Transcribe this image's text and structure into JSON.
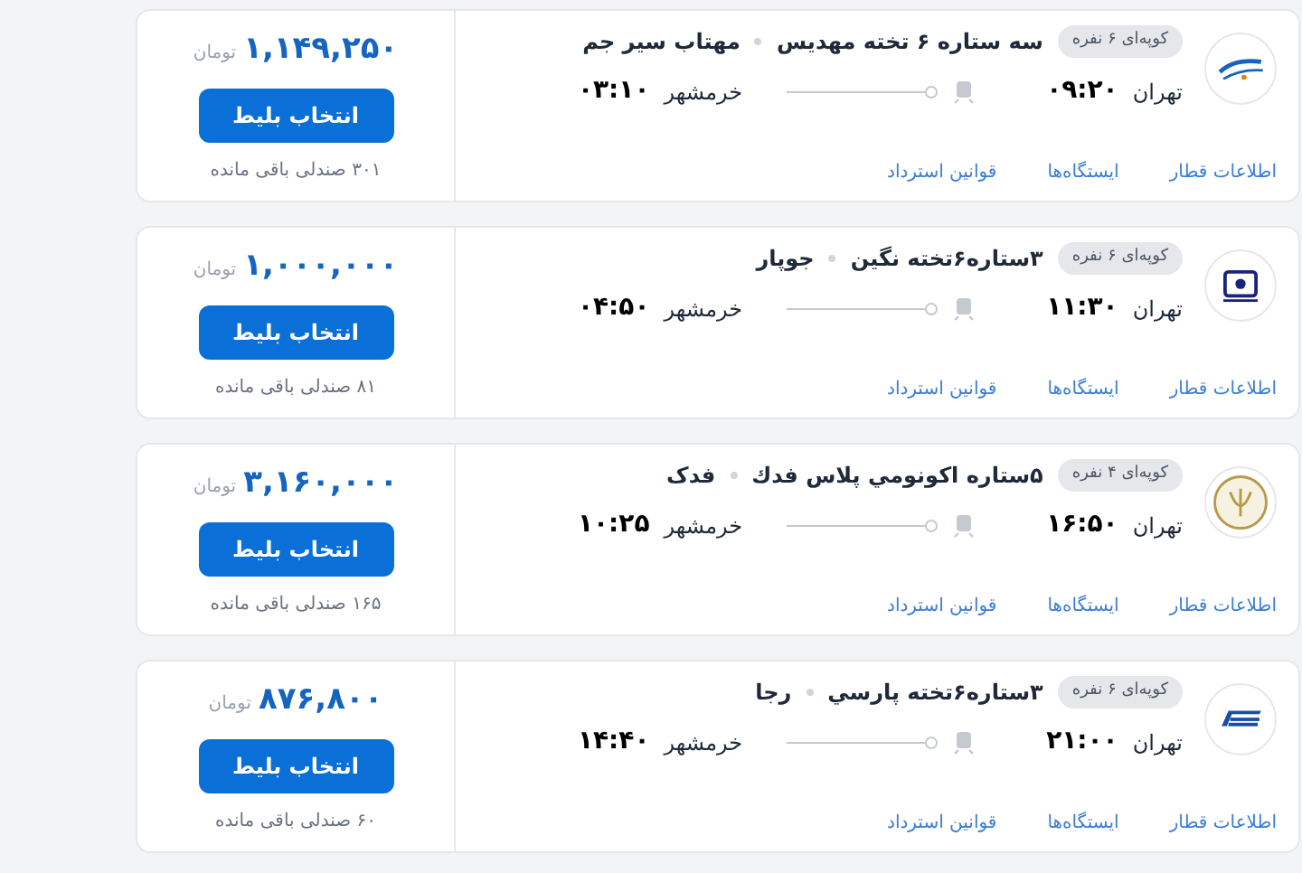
{
  "trips": [
    {
      "logo": {
        "kind": "wave"
      },
      "coupe": "کوپه‌ای ۶ نفره",
      "train_name": "سه ستاره ۶ تخته مهدیس",
      "company": "مهتاب سیر جم",
      "origin": "تهران",
      "depart": "۰۹:۲۰",
      "destination": "خرمشهر",
      "arrive": "۰۳:۱۰",
      "links": [
        "اطلاعات قطار",
        "ایستگاه‌ها",
        "قوانین استرداد"
      ],
      "price": "۱,۱۴۹,۲۵۰",
      "currency": "تومان",
      "button": "انتخاب بلیط",
      "seats": "۳۰۱ صندلی باقی مانده"
    },
    {
      "logo": {
        "kind": "square"
      },
      "coupe": "کوپه‌ای ۶ نفره",
      "train_name": "۳ستاره۶تخته نگین",
      "company": "جوپار",
      "origin": "تهران",
      "depart": "۱۱:۳۰",
      "destination": "خرمشهر",
      "arrive": "۰۴:۵۰",
      "links": [
        "اطلاعات قطار",
        "ایستگاه‌ها",
        "قوانین استرداد"
      ],
      "price": "۱,۰۰۰,۰۰۰",
      "currency": "تومان",
      "button": "انتخاب بلیط",
      "seats": "۸۱ صندلی باقی مانده"
    },
    {
      "logo": {
        "kind": "emblem"
      },
      "coupe": "کوپه‌ای ۴ نفره",
      "train_name": "۵ستاره اکونومي پلاس فدك",
      "company": "فدک",
      "origin": "تهران",
      "depart": "۱۶:۵۰",
      "destination": "خرمشهر",
      "arrive": "۱۰:۲۵",
      "links": [
        "اطلاعات قطار",
        "ایستگاه‌ها",
        "قوانین استرداد"
      ],
      "price": "۳,۱۶۰,۰۰۰",
      "currency": "تومان",
      "button": "انتخاب بلیط",
      "seats": "۱۶۵ صندلی باقی مانده"
    },
    {
      "logo": {
        "kind": "stripes"
      },
      "coupe": "کوپه‌ای ۶ نفره",
      "train_name": "۳ستاره۶تخته پارسي",
      "company": "رجا",
      "origin": "تهران",
      "depart": "۲۱:۰۰",
      "destination": "خرمشهر",
      "arrive": "۱۴:۴۰",
      "links": [
        "اطلاعات قطار",
        "ایستگاه‌ها",
        "قوانین استرداد"
      ],
      "price": "۸۷۶,۸۰۰",
      "currency": "تومان",
      "button": "انتخاب بلیط",
      "seats": "۶۰ صندلی باقی مانده"
    }
  ]
}
